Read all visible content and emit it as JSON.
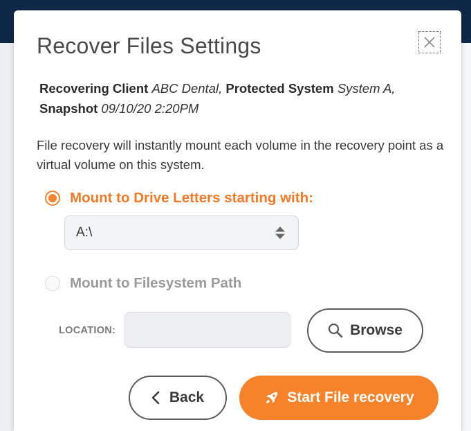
{
  "dialog": {
    "title": "Recover Files Settings",
    "close_icon": "close-icon"
  },
  "summary": {
    "client_label": "Recovering Client",
    "client_value": "ABC Dental,",
    "system_label": "Protected System",
    "system_value": "System A,",
    "snapshot_label": "Snapshot",
    "snapshot_value": "09/10/20 2:20PM"
  },
  "description": "File recovery will instantly mount each volume in the recovery point as a virtual volume on this system.",
  "options": {
    "drive_letters": {
      "label": "Mount to Drive Letters starting with:",
      "selected": true,
      "select_value": "A:\\",
      "select_icon": "sort-arrows-icon"
    },
    "filesystem_path": {
      "label": "Mount to Filesystem Path",
      "selected": false,
      "location_label": "LOCATION:",
      "location_value": "",
      "browse_label": "Browse",
      "browse_icon": "search-icon"
    }
  },
  "actions": {
    "back_label": "Back",
    "back_icon": "chevron-left-icon",
    "start_label": "Start File recovery",
    "start_icon": "rocket-icon"
  },
  "colors": {
    "accent": "#f6822a",
    "header_bg": "#0f2847"
  }
}
